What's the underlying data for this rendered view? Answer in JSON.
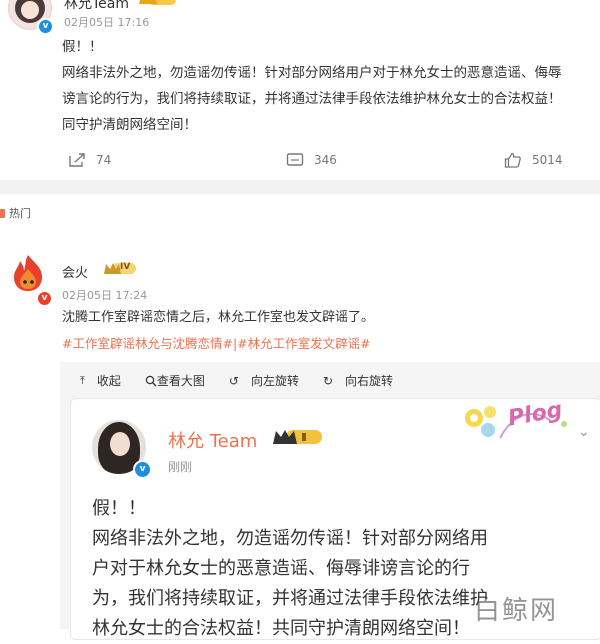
{
  "post1": {
    "author": "林允Team",
    "time": "02月05日 17:16",
    "text_lines": [
      "假！！",
      "网络非法外之地，勿造谣勿传谣！针对部分网络用户对于林允女士的恶意造谣、侮辱",
      "谤言论的行为，我们将持续取证，并将通过法律手段依法维护林允女士的合法权益！",
      "同守护清朗网络空间！"
    ],
    "repost_count": "74",
    "comment_count": "346",
    "like_count": "5014"
  },
  "section_label": "热门",
  "post2": {
    "author": "会火",
    "level": "IV",
    "time": "02月05日 17:24",
    "text": "沈腾工作室辟谣恋情之后，林允工作室也发文辟谣了。",
    "hashtags": "#工作室辟谣林允与沈腾恋情#|#林允工作室发文辟谣#",
    "toolbar": {
      "collapse": "收起",
      "view_large": "查看大图",
      "rotate_left": "向左旋转",
      "rotate_right": "向右旋转"
    }
  },
  "quoted": {
    "author": "林允 Team",
    "time": "刚刚",
    "sticker_text": "Plog",
    "text_lines": [
      "假！！",
      "网络非法外之地，勿造谣勿传谣！针对部分网络用",
      "户对于林允女士的恶意造谣、侮辱诽谤言论的行",
      "为，我们将持续取证，并将通过法律手段依法维护",
      "林允女士的合法权益！共同守护清朗网络空间！"
    ]
  },
  "watermark": "白鲸网",
  "colors": {
    "accent": "#eb7350",
    "verified": "#1d8fe0",
    "gold": "#e6a817"
  }
}
